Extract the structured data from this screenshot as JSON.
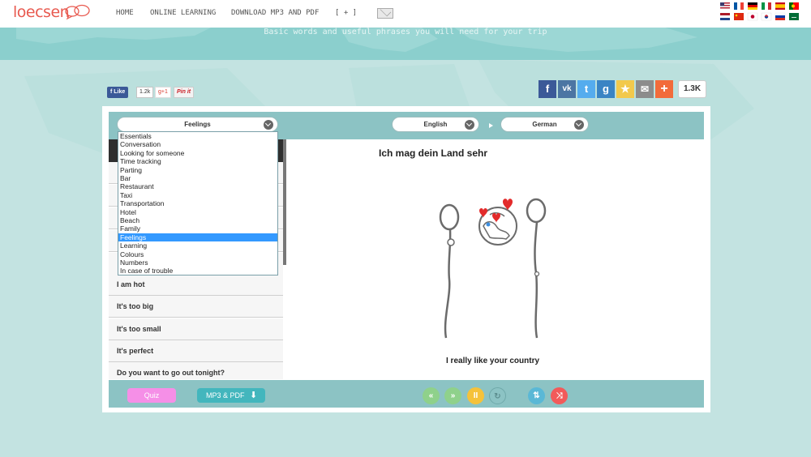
{
  "brand": {
    "logo_text": "loecsen"
  },
  "nav": {
    "items": [
      "HOME",
      "ONLINE LEARNING",
      "DOWNLOAD MP3 AND PDF",
      "[ + ]"
    ],
    "mail_icon": "envelope-icon"
  },
  "banner": {
    "tagline": "Basic words and useful phrases you will need for your trip"
  },
  "social": {
    "fb_like": "Like",
    "fb_count": "1.2k",
    "gplus": "g+1",
    "pinit": "Pin it",
    "share_count": "1.3K",
    "share_buttons": [
      {
        "name": "facebook",
        "glyph": "f",
        "color": "#3b5998"
      },
      {
        "name": "vkontakte",
        "glyph": "vk",
        "color": "#4c75a3"
      },
      {
        "name": "twitter",
        "glyph": "t",
        "color": "#55acee"
      },
      {
        "name": "google",
        "glyph": "g",
        "color": "#3a84c4"
      },
      {
        "name": "favorite",
        "glyph": "★",
        "color": "#f2c94c"
      },
      {
        "name": "email",
        "glyph": "✉",
        "color": "#8c8c8c"
      },
      {
        "name": "more",
        "glyph": "+",
        "color": "#f26b3a"
      }
    ]
  },
  "selectors": {
    "category": "Feelings",
    "language_from": "English",
    "language_to": "German"
  },
  "dropdown": {
    "options": [
      "Essentials",
      "Conversation",
      "Looking for someone",
      "Time tracking",
      "Parting",
      "Bar",
      "Restaurant",
      "Taxi",
      "Transportation",
      "Hotel",
      "Beach",
      "Family",
      "Feelings",
      "Learning",
      "Colours",
      "Numbers",
      "In case of trouble"
    ],
    "selected": "Feelings"
  },
  "phrase_list": [
    "I am hot",
    "It's too big",
    "It's too small",
    "It's perfect",
    "Do you want to go out tonight?"
  ],
  "stage": {
    "phrase_target": "Ich mag dein Land sehr",
    "phrase_source": "I really like your country"
  },
  "controls": {
    "quiz": "Quiz",
    "mp3_pdf": "MP3 & PDF",
    "colors": {
      "quiz": "#f58fe7",
      "mp3": "#43b6bd",
      "nav_green": "#8fd18b",
      "pause": "#f5c23a",
      "shuffle": "#f25a5a",
      "settings": "#5ab8d6"
    }
  },
  "flags": [
    "us",
    "fr",
    "de",
    "it",
    "es",
    "pt",
    "nl",
    "cn",
    "jp",
    "kr",
    "ru",
    "sa"
  ]
}
